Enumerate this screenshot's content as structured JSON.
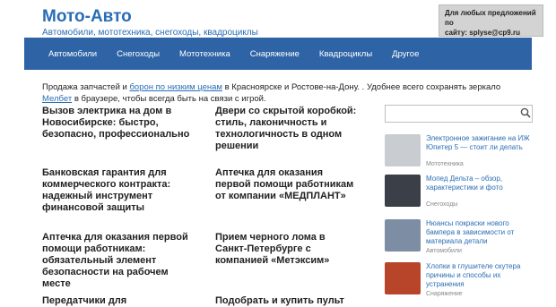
{
  "header": {
    "title": "Мото-Авто",
    "description": "Автомобили, мототехника, снегоходы, квадроциклы",
    "ad_line1": "Для любых предложений по",
    "ad_line2": "сайту: splyse@cp9.ru"
  },
  "nav": {
    "items": [
      "Автомобили",
      "Снегоходы",
      "Мототехника",
      "Снаряжение",
      "Квадроциклы",
      "Другое"
    ]
  },
  "notice": {
    "t1": "Продажа запчастей и ",
    "link1": "борон по низким ценам",
    "t2": " в Красноярске и Ростове-на-Дону. . Удобнее всего сохранять зеркало ",
    "link2": "Мелбет",
    "t3": " в браузере, чтобы всегда быть на связи с игрой."
  },
  "posts": [
    "Вызов электрика на дом в Новосибирске: быстро, безопасно, профессионально",
    "Двери со скрытой коробкой: стиль, лаконичность и технологичность в одном решении",
    "Банковская гарантия для коммерческого контракта: надежный инструмент финансовой защиты",
    "Аптечка для оказания первой помощи работникам от компании «МЕДПЛАНТ»",
    "Аптечка для оказания первой помощи работникам: обязательный элемент безопасности на рабочем месте",
    "Прием черного лома в Санкт-Петербурге с компанией «Метэксим»",
    "Передатчики для квадрокоптеров:",
    "Подобрать и купить пульт"
  ],
  "sidebar": {
    "items": [
      {
        "title": "Электронное зажигание на ИЖ Юпитер 5 — стоит ли делать",
        "category": "Мототехника",
        "color": "#c9ccd1"
      },
      {
        "title": "Мопед Дельта – обзор, характеристики и фото",
        "category": "Снегоходы",
        "color": "#3a3f48"
      },
      {
        "title": "Нюансы покраски нового бампера в зависимости от материала детали",
        "category": "Автомобили",
        "color": "#7d8da3"
      },
      {
        "title": "Хлопки в глушителе скутера причины и способы их устранения",
        "category": "Снаряжение",
        "color": "#b8452a"
      }
    ]
  }
}
